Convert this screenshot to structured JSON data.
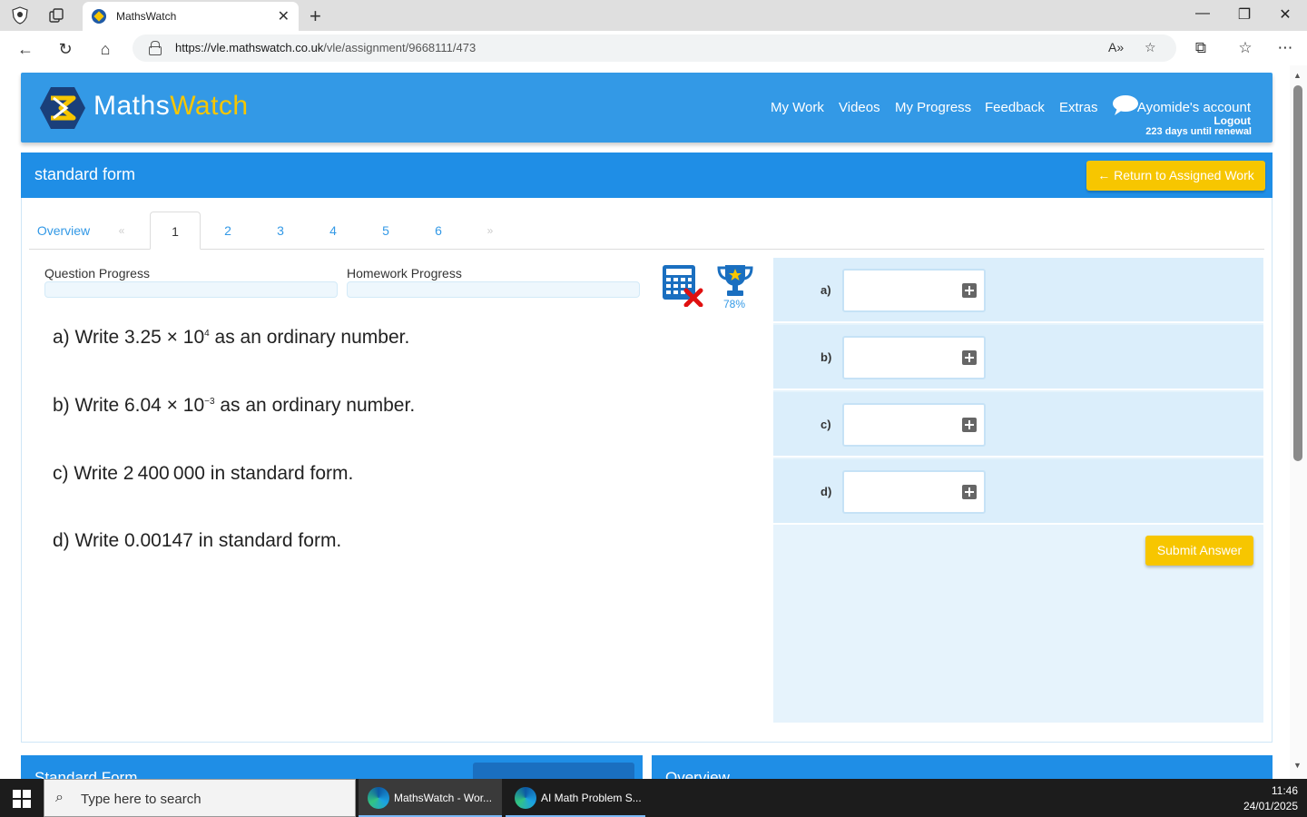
{
  "browser": {
    "tab_title": "MathsWatch",
    "url_host": "https://vle.mathswatch.co.uk",
    "url_path": "/vle/assignment/9668111/473"
  },
  "header": {
    "logo_maths": "Maths",
    "logo_watch": "Watch",
    "nav": [
      "My Work",
      "Videos",
      "My Progress",
      "Feedback",
      "Extras"
    ],
    "account": "Ayomide's account",
    "logout": "Logout",
    "renewal": "223 days until renewal"
  },
  "topic": {
    "title": "standard form",
    "return_button": "← Return to Assigned Work"
  },
  "tabs": {
    "overview": "Overview",
    "prev": "«",
    "next": "»",
    "numbers": [
      "1",
      "2",
      "3",
      "4",
      "5",
      "6"
    ]
  },
  "progress": {
    "question_label": "Question Progress",
    "homework_label": "Homework Progress",
    "question_value": 0,
    "homework_value": 0
  },
  "trophy_percent": "78%",
  "questions": {
    "a": {
      "pre": "a) Write 3.25 × 10",
      "sup": "4",
      "post": " as an ordinary number."
    },
    "b": {
      "pre": "b) Write 6.04 × 10",
      "sup": "−3",
      "post": " as an ordinary number."
    },
    "c": {
      "text": "c) Write 2 400 000 in standard form."
    },
    "d": {
      "text": "d) Write 0.00147 in standard form."
    }
  },
  "answers": {
    "labels": [
      "a)",
      "b)",
      "c)",
      "d)"
    ],
    "submit": "Submit Answer"
  },
  "bottom": {
    "left_title": "Standard Form",
    "right_title": "Overview"
  },
  "taskbar": {
    "search_placeholder": "Type here to search",
    "app1": "MathsWatch - Wor...",
    "app2": "AI Math Problem S...",
    "time": "11:46",
    "date": "24/01/2025"
  },
  "colors": {
    "brand_blue": "#3399e6",
    "title_blue": "#1f8ee6",
    "accent_yellow": "#f7c600"
  }
}
